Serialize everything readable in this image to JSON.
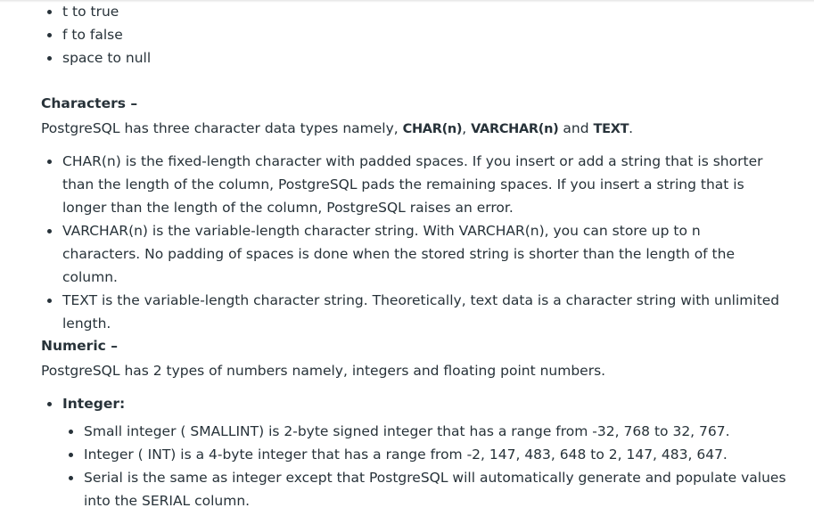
{
  "top_list": [
    "t to true",
    "f to false",
    "space to null"
  ],
  "characters": {
    "heading": "Characters –",
    "intro_prefix": "PostgreSQL has three character data types namely, ",
    "types": [
      "CHAR(n)",
      "VARCHAR(n)",
      "TEXT"
    ],
    "sep1": ", ",
    "sep2": " and ",
    "intro_suffix": ".",
    "items": [
      "CHAR(n) is the fixed-length character with padded spaces. If you insert or add a string that is shorter than the length of the column, PostgreSQL pads the remaining spaces. If you insert a string that is longer than the length of the column, PostgreSQL raises an error.",
      "VARCHAR(n) is the variable-length character string. With VARCHAR(n), you can store up to n characters. No padding of spaces is done when the stored string is shorter than the length of the column.",
      "TEXT is the variable-length character string. Theoretically, text data is a character string with unlimited length."
    ]
  },
  "numeric": {
    "heading": "Numeric –",
    "intro": "PostgreSQL has 2 types of numbers namely, integers and floating point numbers.",
    "integer_label": "Integer:",
    "integer_items": [
      "Small integer ( SMALLINT) is 2-byte signed integer that has a range from -32, 768 to 32, 767.",
      "Integer ( INT) is a 4-byte integer that has a range from -2, 147, 483, 648 to 2, 147, 483, 647.",
      "Serial is the same as integer except that PostgreSQL will automatically generate and populate values into the SERIAL column."
    ]
  }
}
